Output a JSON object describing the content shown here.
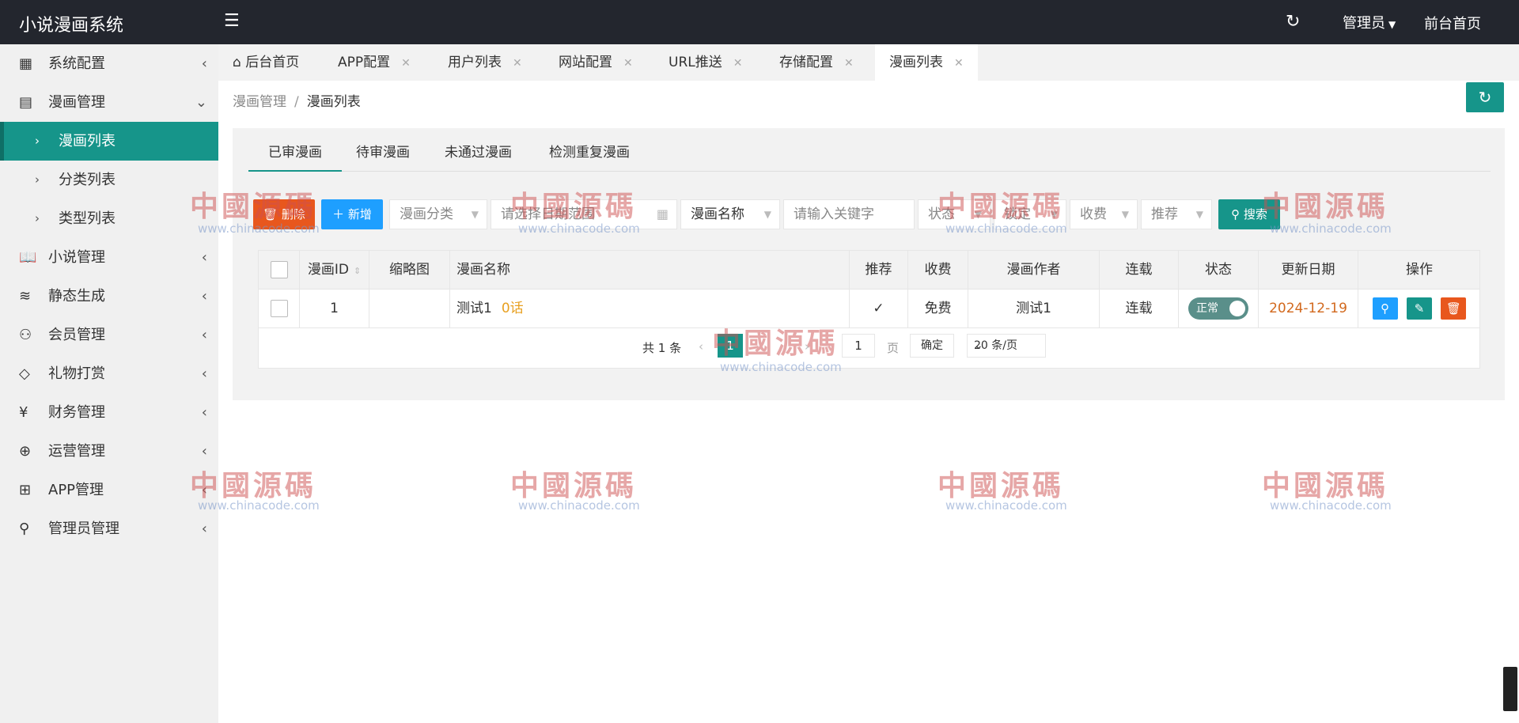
{
  "app": {
    "title": "小说漫画系统"
  },
  "header": {
    "admin_label": "管理员",
    "front_home": "前台首页"
  },
  "sidebar": {
    "items": [
      {
        "label": "系统配置",
        "icon": "dashboard-grid-icon"
      },
      {
        "label": "漫画管理",
        "icon": "book-icon",
        "expanded": true,
        "children": [
          {
            "label": "漫画列表",
            "active": true
          },
          {
            "label": "分类列表"
          },
          {
            "label": "类型列表"
          }
        ]
      },
      {
        "label": "小说管理",
        "icon": "open-book-icon"
      },
      {
        "label": "静态生成",
        "icon": "layers-icon"
      },
      {
        "label": "会员管理",
        "icon": "user-icon"
      },
      {
        "label": "礼物打赏",
        "icon": "diamond-icon"
      },
      {
        "label": "财务管理",
        "icon": "yen-icon"
      },
      {
        "label": "运营管理",
        "icon": "globe-icon"
      },
      {
        "label": "APP管理",
        "icon": "windows-icon"
      },
      {
        "label": "管理员管理",
        "icon": "admin-user-icon"
      }
    ]
  },
  "tabs": [
    {
      "label": "后台首页",
      "home": true
    },
    {
      "label": "APP配置"
    },
    {
      "label": "用户列表"
    },
    {
      "label": "网站配置"
    },
    {
      "label": "URL推送"
    },
    {
      "label": "存储配置"
    },
    {
      "label": "漫画列表",
      "active": true
    }
  ],
  "breadcrumb": {
    "parent": "漫画管理",
    "sep": "/",
    "current": "漫画列表"
  },
  "subtabs": [
    "已审漫画",
    "待审漫画",
    "未通过漫画",
    "检测重复漫画"
  ],
  "toolbar": {
    "delete_label": "删除",
    "add_label": "新增",
    "category_placeholder": "漫画分类",
    "date_placeholder": "请选择日期范围",
    "field_select": "漫画名称",
    "keyword_placeholder": "请输入关键字",
    "status_placeholder": "状态",
    "lock_placeholder": "锁定",
    "fee_placeholder": "收费",
    "recommend_placeholder": "推荐",
    "search_label": "搜索"
  },
  "table": {
    "headers": [
      "漫画ID",
      "缩略图",
      "漫画名称",
      "推荐",
      "收费",
      "漫画作者",
      "连载",
      "状态",
      "更新日期",
      "操作"
    ],
    "rows": [
      {
        "id": "1",
        "thumb": "",
        "name": "测试1",
        "episodes": "0话",
        "recommend": "✓",
        "fee": "免费",
        "author": "测试1",
        "serial": "连载",
        "status": "正常",
        "date": "2024-12-19"
      }
    ]
  },
  "pager": {
    "total": "共 1 条",
    "current_page": "1",
    "goto_value": "1",
    "page_unit": "页",
    "confirm": "确定",
    "page_size": "20 条/页"
  },
  "watermark": {
    "text": "中國源碼",
    "url": "www.chinacode.com"
  },
  "colors": {
    "primary": "#16958a",
    "danger": "#e8571d",
    "info": "#1e9fff",
    "topbar": "#23262e"
  }
}
